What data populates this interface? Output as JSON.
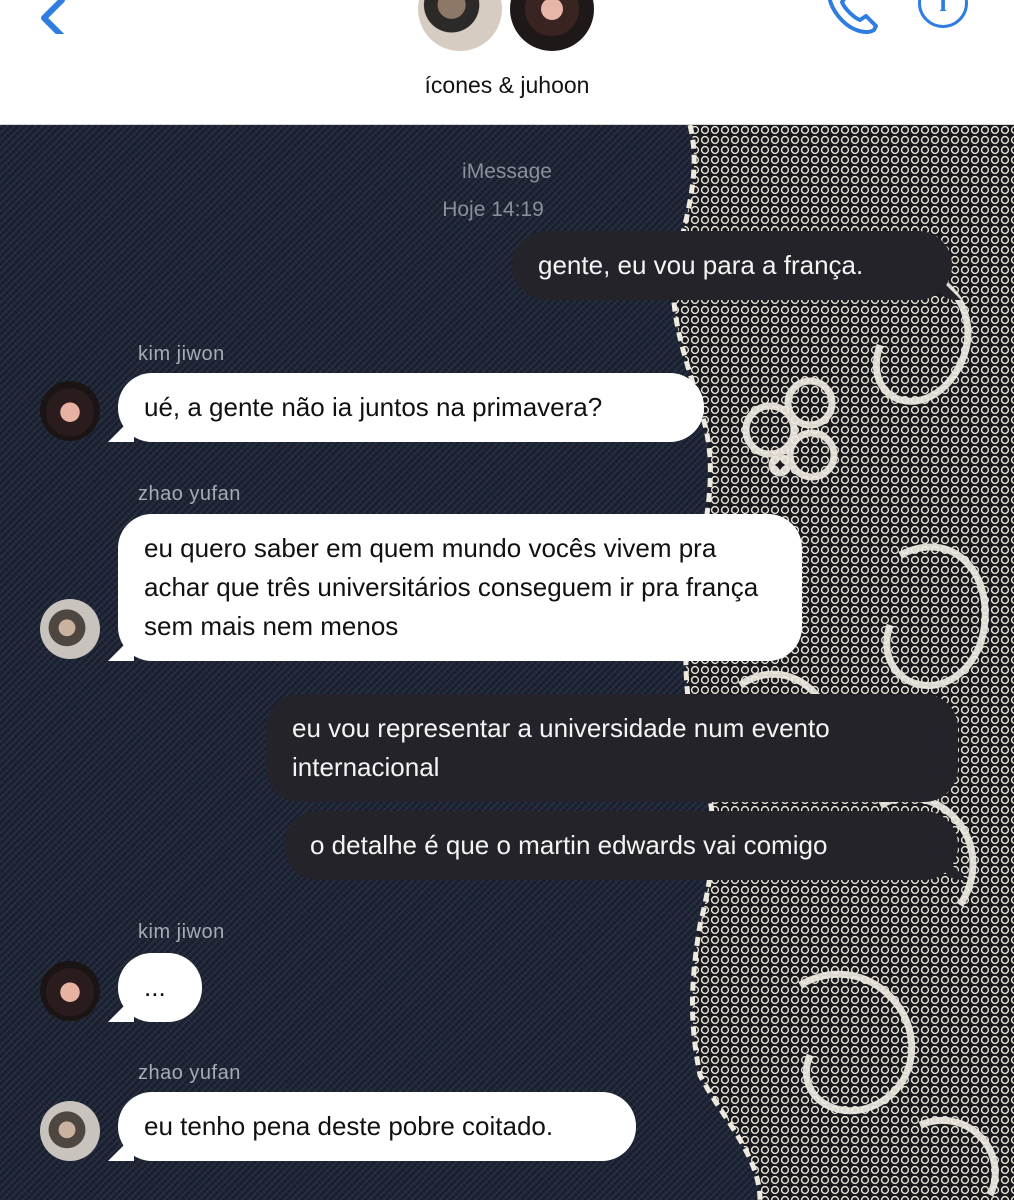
{
  "header": {
    "title": "ícones & juhoon",
    "accent_color": "#2f7de1",
    "back_icon": "chevron-left-icon",
    "call_icon": "phone-icon",
    "info_icon": "info-icon",
    "info_glyph": "i"
  },
  "chat": {
    "service": "iMessage",
    "timestamp": "Hoje 14:19",
    "messages": [
      {
        "from": "me",
        "text": "gente, eu vou para a frança."
      },
      {
        "sender": "kim jiwon",
        "text": "ué, a gente não ia juntos na primavera?"
      },
      {
        "sender": "zhao yufan",
        "text": "eu quero saber em quem mundo vocês vivem pra achar que três universitários conseguem ir pra frança sem mais nem menos"
      },
      {
        "from": "me",
        "text": "eu vou representar a universidade num evento internacional"
      },
      {
        "from": "me",
        "text": "o detalhe é que o martin edwards vai comigo"
      },
      {
        "sender": "kim jiwon",
        "text": "..."
      },
      {
        "sender": "zhao yufan",
        "text": "eu tenho pena deste pobre coitado."
      }
    ]
  }
}
